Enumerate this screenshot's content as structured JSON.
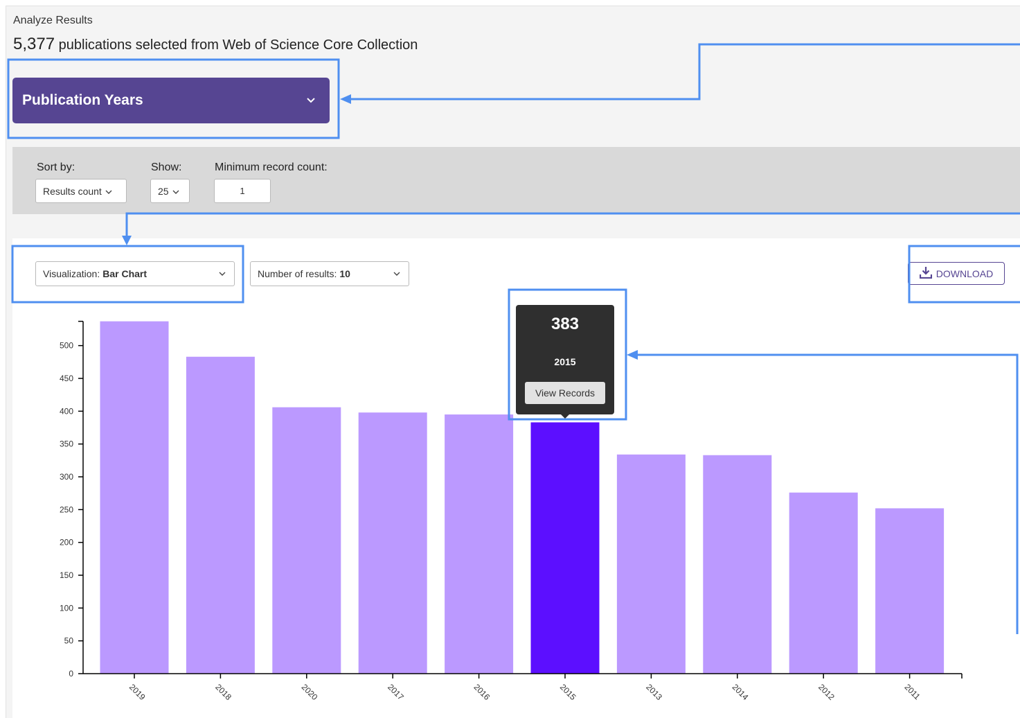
{
  "header": {
    "breadcrumb": "Analyze Results",
    "count": "5,377",
    "subtitle": "publications selected from Web of Science Core Collection"
  },
  "field_selector": {
    "label": "Publication Years",
    "icon": "chevron-down-icon"
  },
  "filters": {
    "sort_label": "Sort by:",
    "sort_value": "Results count",
    "show_label": "Show:",
    "show_value": "25",
    "min_label": "Minimum record count:",
    "min_value": "1"
  },
  "viz": {
    "visualization_label": "Visualization:",
    "visualization_value": "Bar Chart",
    "results_label": "Number of results:",
    "results_value": "10",
    "download_label": "DOWNLOAD",
    "download_icon": "download-icon"
  },
  "tooltip": {
    "value": "383",
    "year": "2015",
    "button": "View Records"
  },
  "colors": {
    "bar": "#bb99ff",
    "bar_highlight": "#5c0fff",
    "header_purple": "#564592",
    "annotation": "#4f8ff0"
  },
  "chart_data": {
    "type": "bar",
    "categories": [
      "2019",
      "2018",
      "2020",
      "2017",
      "2016",
      "2015",
      "2013",
      "2014",
      "2012",
      "2011"
    ],
    "values": [
      537,
      483,
      406,
      398,
      395,
      383,
      334,
      333,
      276,
      252
    ],
    "highlighted": "2015",
    "yticks": [
      0,
      50,
      100,
      150,
      200,
      250,
      300,
      350,
      400,
      450,
      500
    ],
    "ylim": [
      0,
      537
    ],
    "grid": false,
    "title": "",
    "xlabel": "",
    "ylabel": ""
  }
}
